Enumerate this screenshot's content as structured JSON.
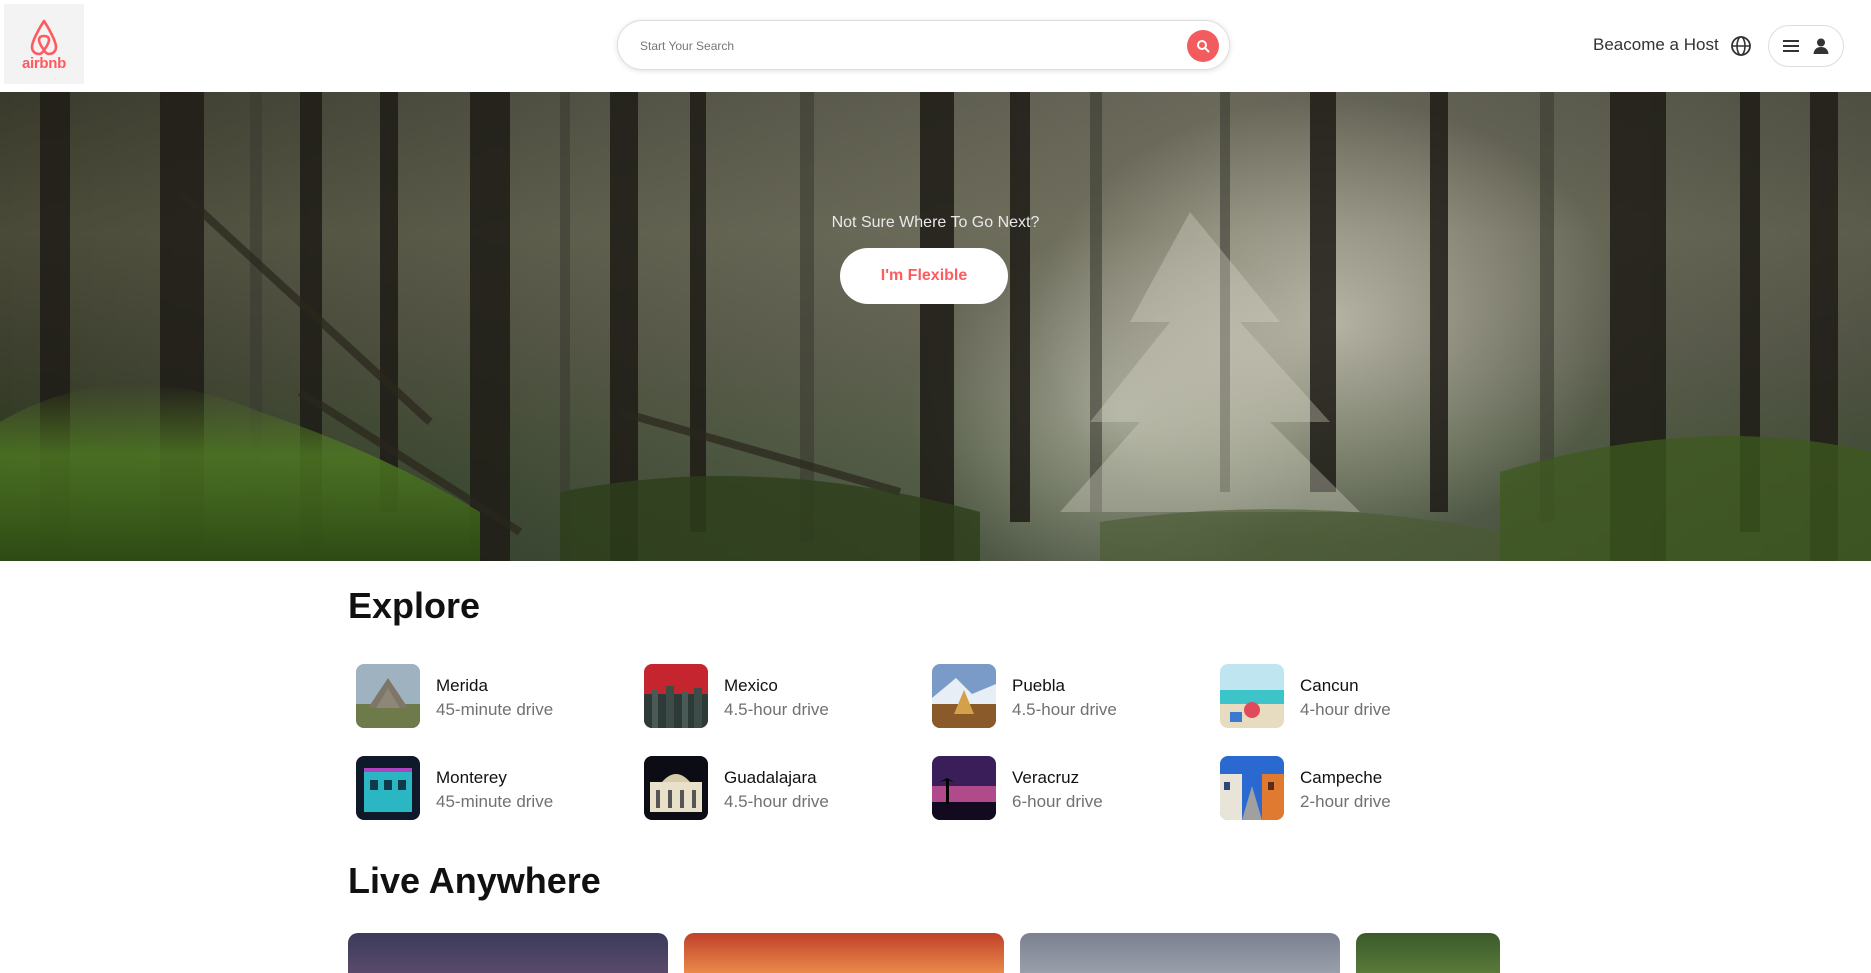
{
  "header": {
    "logo_text": "airbnb",
    "search_placeholder": "Start Your Search",
    "host_link": "Beacome a Host",
    "brand_color": "#ff5a5f"
  },
  "hero": {
    "tagline": "Not Sure Where To Go Next?",
    "button_label": "I'm Flexible"
  },
  "explore": {
    "title": "Explore",
    "destinations": [
      {
        "name": "Merida",
        "drive": "45-minute drive"
      },
      {
        "name": "Mexico",
        "drive": "4.5-hour drive"
      },
      {
        "name": "Puebla",
        "drive": "4.5-hour drive"
      },
      {
        "name": "Cancun",
        "drive": "4-hour drive"
      },
      {
        "name": "Monterey",
        "drive": "45-minute drive"
      },
      {
        "name": "Guadalajara",
        "drive": "4.5-hour drive"
      },
      {
        "name": "Veracruz",
        "drive": "6-hour drive"
      },
      {
        "name": "Campeche",
        "drive": "2-hour drive"
      }
    ]
  },
  "live_anywhere": {
    "title": "Live Anywhere"
  }
}
